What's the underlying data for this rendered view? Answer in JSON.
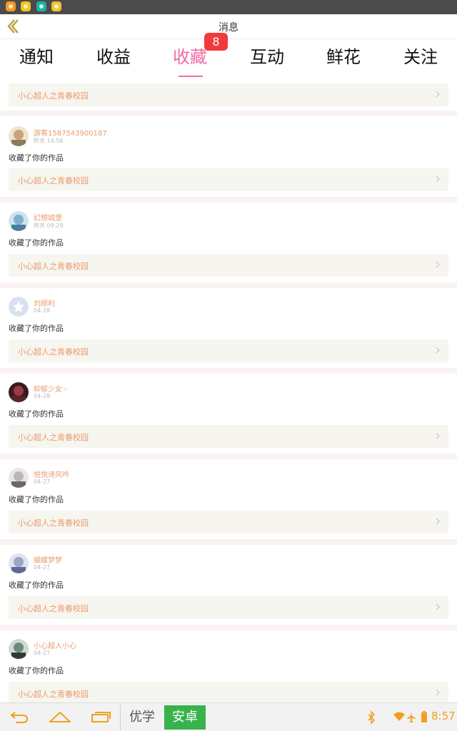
{
  "header": {
    "title": "消息"
  },
  "tabs": [
    {
      "label": "通知"
    },
    {
      "label": "收益"
    },
    {
      "label": "收藏"
    },
    {
      "label": "互动"
    },
    {
      "label": "鲜花"
    },
    {
      "label": "关注"
    }
  ],
  "active_tab_index": 2,
  "favorite_badge": "8",
  "colors": {
    "accent": "#f06ba3",
    "badge": "#f13a3a",
    "name": "#ea9a6c",
    "work_bg": "#f6f5ef"
  },
  "first_work_title": "小心超人之青春校园",
  "items": [
    {
      "user": "游客1587543900187",
      "time": "昨天 14:56",
      "action": "收藏了你的作品",
      "work": "小心超人之青春校园"
    },
    {
      "user": "幻想城堡",
      "time": "昨天 09:29",
      "action": "收藏了你的作品",
      "work": "小心超人之青春校园"
    },
    {
      "user": "刘顺利",
      "time": "04-28",
      "action": "收藏了你的作品",
      "work": "小心超人之青春校园"
    },
    {
      "user": "抑郁少女☜",
      "time": "04-28",
      "action": "收藏了你的作品",
      "work": "小心超人之青春校园"
    },
    {
      "user": "悦悦诗风吟",
      "time": "04-27",
      "action": "收藏了你的作品",
      "work": "小心超人之青春校园"
    },
    {
      "user": "蝴蝶梦梦",
      "time": "04-27",
      "action": "收藏了你的作品",
      "work": "小心超人之青春校园"
    },
    {
      "user": "小心超人小心",
      "time": "04-27",
      "action": "收藏了你的作品",
      "work": "小心超人之青春校园"
    }
  ],
  "navbar": {
    "ime_options": [
      "优学",
      "安卓"
    ],
    "clock": "8:57"
  }
}
